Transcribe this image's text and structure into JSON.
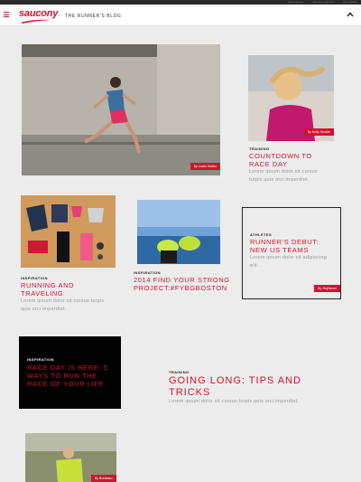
{
  "topbar": {
    "links": [
      "saucony.com",
      "saucony originals",
      "store locator"
    ]
  },
  "header": {
    "logo_text": "saucony",
    "blog_title": "THE RUNNER'S BLOG",
    "menu_icon": "menu-icon",
    "collapse_icon": "chevron-up-icon"
  },
  "colors": {
    "accent": "#d2122e",
    "bg": "#ececec",
    "text_muted": "#999999"
  },
  "cards": [
    {
      "id": "hero",
      "credit": "By Justin Hobbs"
    },
    {
      "id": "countdown",
      "credit": "By Molly Huddle",
      "category": "TRAINING",
      "title": "COUNTDOWN TO RACE DAY",
      "body": "Lorem ipsum dolor sit cursus turpis quis orci imperdiet."
    },
    {
      "id": "running-traveling",
      "category": "INSPIRATION",
      "title": "RUNNING AND TRAVELING",
      "body": "Lorem ipsum dolor sit cursus turpis quis orci imperdiet."
    },
    {
      "id": "fybgboston",
      "category": "INSPIRATION",
      "title": "2014 FIND YOUR STRONG PROJECT:#FYBGBOSTON"
    },
    {
      "id": "runners-debut",
      "credit": "By Jfoyhaven",
      "category": "ATHLETES",
      "title": "RUNNER'S DEBUT: NEW US TEAMS",
      "body": "Lorem ipsum dolor sit adipiscing elit."
    },
    {
      "id": "race-day",
      "category": "INSPIRATION",
      "title": "RACE DAY IS HERE: 5 WAYS TO RUN THE RACE OF YOUR LIFE"
    },
    {
      "id": "going-long",
      "category": "TRAINING",
      "title": "GOING LONG: TIPS AND TRICKS",
      "body": "Lorem ipsum dolor sit cursus turpis quis orci imperdiet."
    },
    {
      "id": "trail",
      "credit": "By Bordeaux"
    }
  ]
}
